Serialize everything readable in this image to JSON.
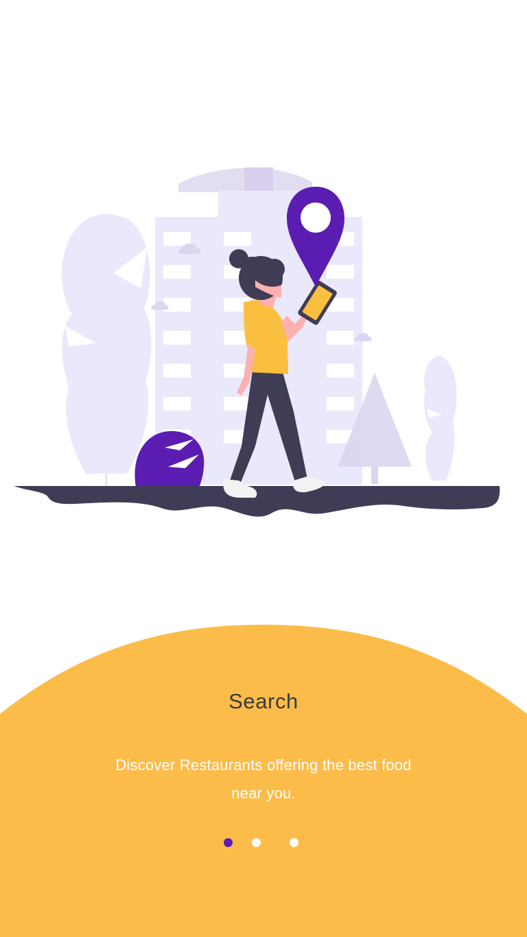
{
  "onboarding": {
    "title": "Search",
    "description": "Discover Restaurants offering the best food near you.",
    "page_indicator": {
      "total": 3,
      "active_index": 0
    }
  },
  "colors": {
    "accent": "#5B1DB1",
    "panel": "#FCBC4A",
    "ground": "#3F3D56",
    "background_shapes": "#EAE8FB",
    "dot_inactive": "#FFFFFF"
  },
  "illustration": {
    "icon": "woman-walking-with-phone-location-pin-illustration"
  }
}
